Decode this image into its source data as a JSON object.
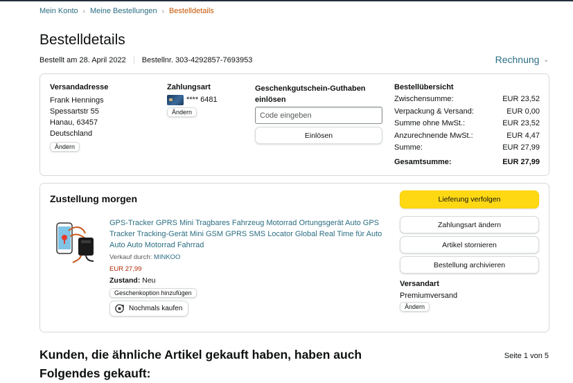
{
  "breadcrumb": {
    "items": [
      "Mein Konto",
      "Meine Bestellungen"
    ],
    "current": "Bestelldetails",
    "separator": "›"
  },
  "page": {
    "title": "Bestelldetails",
    "order_date": "Bestellt am 28. April 2022",
    "order_number": "Bestellnr. 303-4292857-7693953",
    "invoice_label": "Rechnung"
  },
  "shipping": {
    "heading": "Versandadresse",
    "lines": [
      "Frank Hennings",
      "Spessartstr 55",
      "Hanau, 63457",
      "Deutschland"
    ],
    "change_label": "Ändern"
  },
  "payment": {
    "heading": "Zahlungsart",
    "card_digits": "**** 6481",
    "change_label": "Ändern"
  },
  "gift": {
    "heading": "Geschenkgutschein-Guthaben einlösen",
    "placeholder": "Code eingeben",
    "redeem_label": "Einlösen"
  },
  "summary": {
    "heading": "Bestellübersicht",
    "rows": [
      {
        "label": "Zwischensumme:",
        "value": "EUR 23,52"
      },
      {
        "label": "Verpackung & Versand:",
        "value": "EUR 0,00"
      },
      {
        "label": "Summe ohne MwSt.:",
        "value": "EUR 23,52"
      },
      {
        "label": "Anzurechnende MwSt.:",
        "value": "EUR 4,47"
      },
      {
        "label": "Summe:",
        "value": "EUR 27,99"
      }
    ],
    "total_label": "Gesamtsumme:",
    "total_value": "EUR 27,99"
  },
  "shipment": {
    "heading": "Zustellung morgen",
    "product_title": "GPS-Tracker GPRS Mini Tragbares Fahrzeug Motorrad Ortungsgerät Auto GPS Tracker Tracking-Gerät Mini GSM GPRS SMS Locator Global Real Time für Auto Auto Auto Motorrad Fahrrad",
    "sold_by_label": "Verkauf durch:",
    "seller": "MINKOO",
    "price": "EUR 27,99",
    "condition_label": "Zustand:",
    "condition_value": "Neu",
    "gift_option_label": "Geschenkoption hinzufügen",
    "buy_again_label": "Nochmals kaufen",
    "actions": {
      "track": "Lieferung verfolgen",
      "change_payment": "Zahlungsart ändern",
      "cancel": "Artikel stornieren",
      "archive": "Bestellung archivieren"
    },
    "shipping_method_heading": "Versandart",
    "shipping_method": "Premiumversand",
    "shipping_change_label": "Ändern"
  },
  "related": {
    "heading": "Kunden, die ähnliche Artikel gekauft haben, haben auch Folgendes gekauft:",
    "pager": "Seite 1 von 5"
  },
  "colors": {
    "link": "#2a6d82",
    "breadcrumb_current": "#c45500",
    "price": "#b12704",
    "primary_button": "#ffd814",
    "border": "#d5d9d9"
  }
}
